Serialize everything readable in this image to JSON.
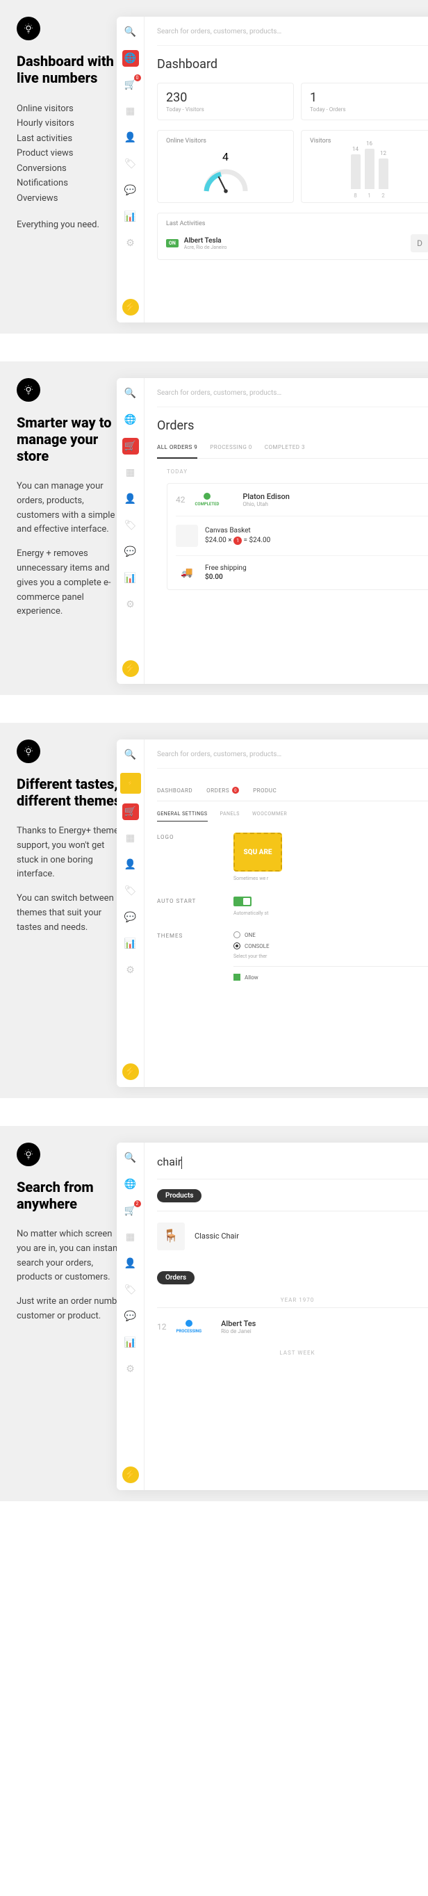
{
  "s1": {
    "heading": "Dashboard with live numbers",
    "features": [
      "Online visitors",
      "Hourly visitors",
      "Last activities",
      "Product views",
      "Conversions",
      "Notifications",
      "Overviews"
    ],
    "tagline": "Everything you need.",
    "app": {
      "search": "Search for orders, customers, products…",
      "title": "Dashboard",
      "stat1_num": "230",
      "stat1_lbl": "Today - Visitors",
      "stat2_num": "1",
      "stat2_lbl": "Today - Orders",
      "panel1_title": "Online Visitors",
      "panel1_num": "4",
      "panel2_title": "Visitors",
      "bars": [
        {
          "v": 14,
          "h": 50
        },
        {
          "v": 16,
          "h": 58
        },
        {
          "v": 12,
          "h": 44
        }
      ],
      "bar_x": [
        "8",
        "1",
        "2"
      ],
      "act_title": "Last Activities",
      "act_badge": "ON",
      "act_name": "Albert Tesla",
      "act_loc": "Acre, Rio de Janeiro",
      "act_d": "D"
    }
  },
  "s2": {
    "heading": "Smarter way to manage your store",
    "p1": "You can manage your orders, products, customers with a simple and effective interface.",
    "p2": "Energy + removes unnecessary items and gives you a complete e-commerce panel experience.",
    "app": {
      "search": "Search for orders, customers, products…",
      "title": "Orders",
      "tabs": [
        {
          "l": "ALL ORDERS 9",
          "a": true
        },
        {
          "l": "PROCESSING 0"
        },
        {
          "l": "COMPLETED 3"
        }
      ],
      "day": "TODAY",
      "order_num": "42",
      "order_status": "COMPLETED",
      "cust_name": "Platon Edison",
      "cust_loc": "Ohio, Utah",
      "prod_name": "Canvas Basket",
      "prod_price": "$24.00",
      "prod_qty": "1",
      "prod_total": "$24.00",
      "ship_name": "Free shipping",
      "ship_price": "$0.00"
    }
  },
  "s3": {
    "heading": "Different tastes, different themes",
    "p1": "Thanks to Energy+ theme support, you won't get stuck in one boring interface.",
    "p2": "You can switch between themes that suit your tastes and needs.",
    "app": {
      "search": "Search for orders, customers, products…",
      "nav": [
        "DASHBOARD",
        "ORDERS",
        "PRODUC"
      ],
      "subtabs": [
        {
          "l": "GENERAL SETTINGS",
          "a": true
        },
        {
          "l": "PANELS"
        },
        {
          "l": "WOOCOMMER"
        }
      ],
      "logo_lbl": "LOGO",
      "logo_txt": "SQU\nARE",
      "logo_hint": "Sometimes we r",
      "auto_lbl": "AUTO START",
      "auto_hint": "Automatically st",
      "theme_lbl": "THEMES",
      "theme_o1": "ONE",
      "theme_o2": "CONSOLE",
      "theme_hint": "Select your ther",
      "theme_allow": "Allow"
    }
  },
  "s4": {
    "heading": "Search from anywhere",
    "p1": "No matter which screen you are in, you can instantly search your orders, products or customers.",
    "p2": "Just write an order number, customer or product.",
    "app": {
      "query": "chair",
      "products_lbl": "Products",
      "prod_result": "Classic Chair",
      "orders_lbl": "Orders",
      "year": "YEAR 1970",
      "ord_num": "12",
      "ord_status": "PROCESSING",
      "ord_name": "Albert Tes",
      "ord_loc": "Rio de Janei",
      "last_week": "LAST WEEK"
    }
  }
}
